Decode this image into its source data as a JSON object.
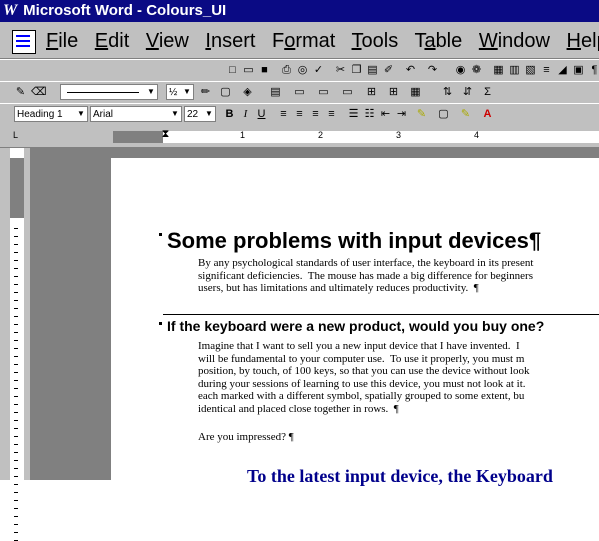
{
  "window": {
    "title": "Microsoft Word - Colours_UI",
    "logo": "W"
  },
  "menu": {
    "items": [
      "File",
      "Edit",
      "View",
      "Insert",
      "Format",
      "Tools",
      "Table",
      "Window",
      "Help"
    ]
  },
  "toolbar2": {
    "line_style": "",
    "font_size_small": "½"
  },
  "format_toolbar": {
    "style": "Heading 1",
    "font": "Arial",
    "size": "22",
    "bold": "B",
    "italic": "I",
    "underline": "U"
  },
  "ruler": {
    "marks": [
      "1",
      "2",
      "3",
      "4"
    ]
  },
  "document": {
    "heading1": "Some problems with input devices¶",
    "para1": "By any psychological standards of user interface, the keyboard in its present\nsignificant deficiencies.  The mouse has made a big difference for beginners\nusers, but has limitations and ultimately reduces productivity.  ¶",
    "heading2": "If the keyboard were a new product, would you buy one?",
    "para2": "Imagine that I want to sell you a new input device that I have invented.  I\nwill be fundamental to your computer use.  To use it properly, you must m\nposition, by touch, of 100 keys, so that you can use the device without look\nduring your sessions of learning to use this device, you must not look at it.\neach marked with a different symbol, spatially grouped to some extent, bu\nidentical and placed close together in rows.  ¶",
    "para3": "Are you impressed? ¶",
    "bluetext": "To the latest input device, the Keyboard"
  }
}
